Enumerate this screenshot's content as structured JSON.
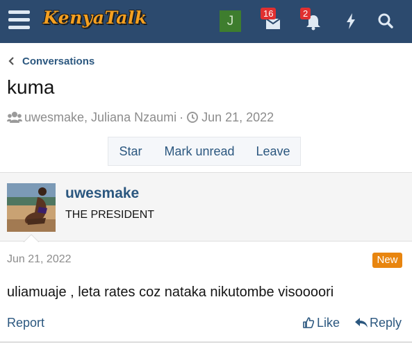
{
  "header": {
    "logo_text": "KenyaTalk",
    "account_initial": "J",
    "inbox_count": "16",
    "alerts_count": "2"
  },
  "breadcrumb": {
    "label": "Conversations"
  },
  "conversation": {
    "title": "kuma",
    "participants": "uwesmake, Juliana Nzaumi",
    "separator": "·",
    "date": "Jun 21, 2022"
  },
  "actions": {
    "star": "Star",
    "mark_unread": "Mark unread",
    "leave": "Leave"
  },
  "message": {
    "username": "uwesmake",
    "user_title": "THE PRESIDENT",
    "date": "Jun 21, 2022",
    "new_label": "New",
    "body": "uliamuaje , leta rates coz nataka nikutombe visoooori",
    "report_label": "Report",
    "like_label": "Like",
    "reply_label": "Reply"
  },
  "colors": {
    "header_bg": "#2c4a6e",
    "link": "#2b577f",
    "logo": "#f5a020",
    "badge": "#e03030",
    "new_badge": "#e8850f",
    "avatar_bg": "#3e7d2e"
  },
  "icons": [
    "menu-icon",
    "inbox-icon",
    "bell-icon",
    "bolt-icon",
    "search-icon",
    "chevron-left-icon",
    "users-icon",
    "clock-icon",
    "thumbs-up-icon",
    "reply-icon"
  ]
}
